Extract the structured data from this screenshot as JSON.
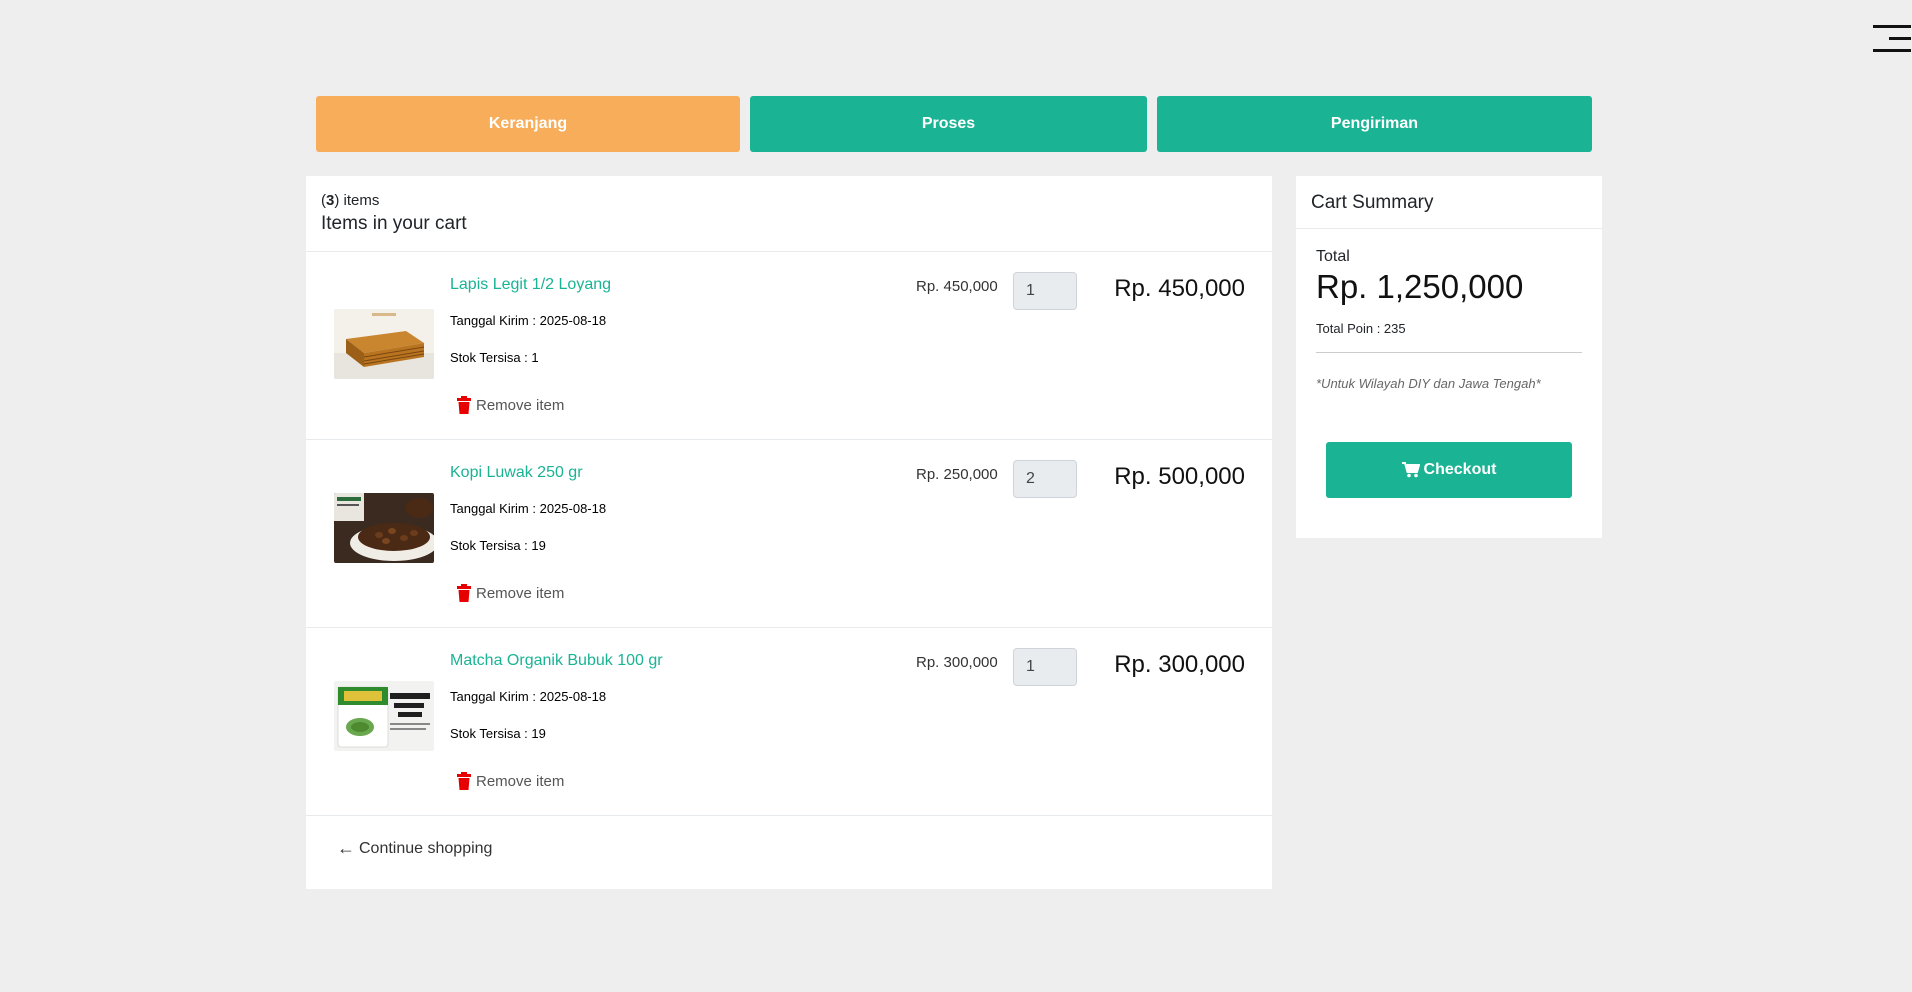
{
  "steps": [
    {
      "label": "Keranjang",
      "active": true
    },
    {
      "label": "Proses",
      "active": false
    },
    {
      "label": "Pengiriman",
      "active": false
    }
  ],
  "cart": {
    "count": "3",
    "count_suffix": ") items",
    "title": "Items in your cart",
    "date_label": "Tanggal Kirim : ",
    "stock_label": "Stok Tersisa : ",
    "remove_label": "Remove item",
    "items": [
      {
        "name": "Lapis Legit 1/2 Loyang",
        "date": "2025-08-18",
        "stock": "1",
        "unit_price": "Rp. 450,000",
        "qty": "1",
        "total": "Rp. 450,000",
        "image": "lapis-legit-cake-image"
      },
      {
        "name": "Kopi Luwak 250 gr",
        "date": "2025-08-18",
        "stock": "19",
        "unit_price": "Rp. 250,000",
        "qty": "2",
        "total": "Rp. 500,000",
        "image": "coffee-beans-image"
      },
      {
        "name": "Matcha Organik Bubuk 100 gr",
        "date": "2025-08-18",
        "stock": "19",
        "unit_price": "Rp. 300,000",
        "qty": "1",
        "total": "Rp. 300,000",
        "image": "matcha-powder-package-image"
      }
    ],
    "continue_label": "Continue shopping"
  },
  "summary": {
    "title": "Cart Summary",
    "total_label": "Total",
    "total": "Rp. 1,250,000",
    "poin": "Total Poin : 235",
    "note": "*Untuk Wilayah DIY dan Jawa Tengah*",
    "checkout_label": "Checkout"
  },
  "colors": {
    "accent": "#1ab394",
    "active_step": "#f7ad5a",
    "background": "#eeeeee"
  },
  "icons": {
    "menu": "hamburger-menu-icon",
    "remove": "trash-icon",
    "continue": "arrow-left-icon",
    "checkout": "cart-icon"
  }
}
